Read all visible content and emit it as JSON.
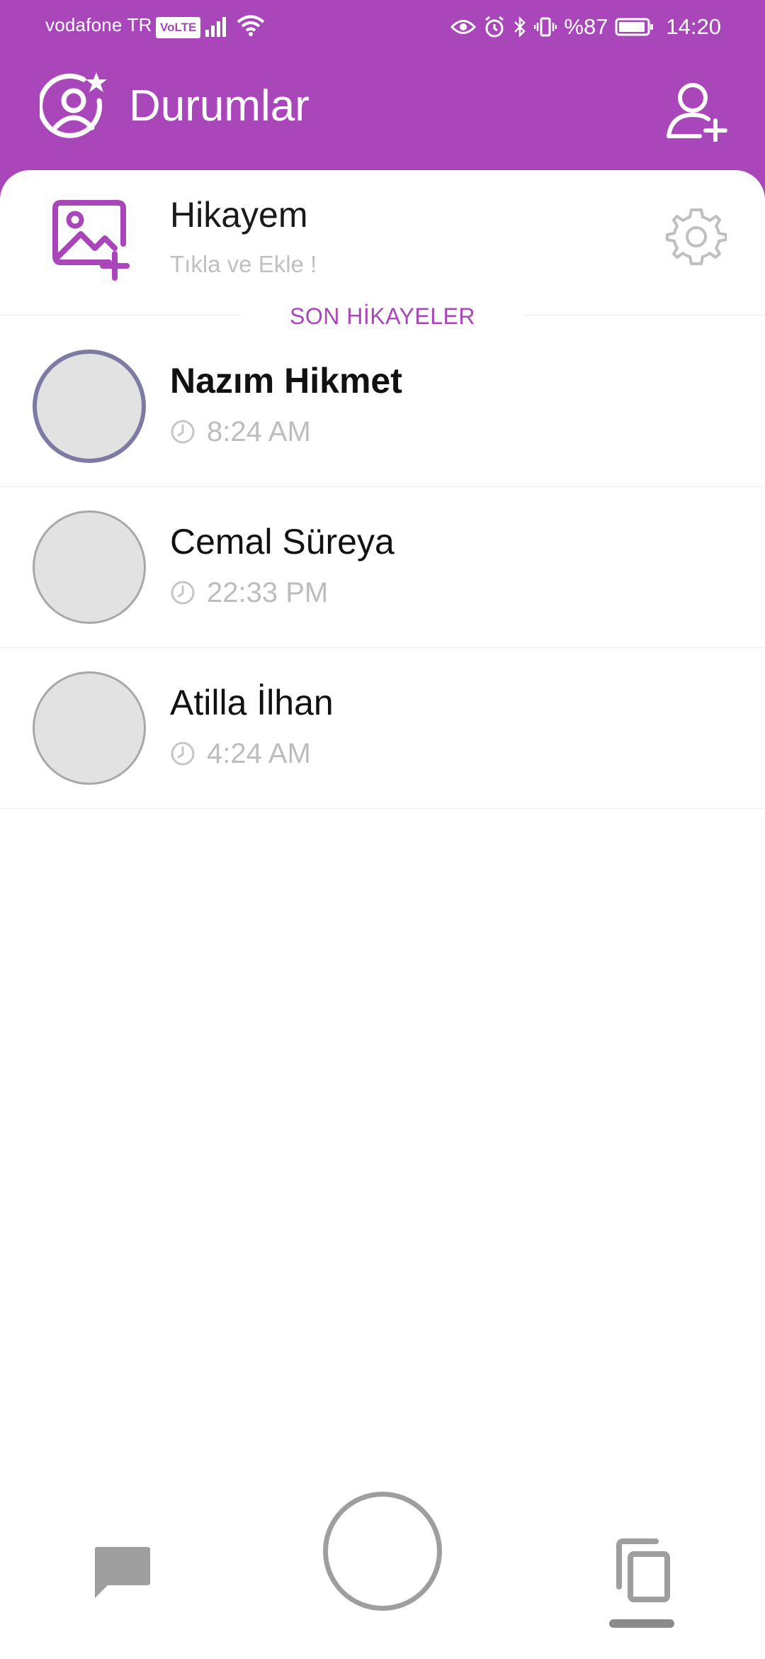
{
  "status_bar": {
    "carrier": "vodafone TR",
    "volte": "VoLTE",
    "battery": "%87",
    "time": "14:20"
  },
  "header": {
    "title": "Durumlar",
    "icons": {
      "title": "user-star-icon",
      "add_user": "add-user-icon"
    }
  },
  "my_story": {
    "name": "Hikayem",
    "hint": "Tıkla ve Ekle !",
    "icons": {
      "add_image": "add-image-icon",
      "settings": "gear-icon"
    }
  },
  "section": {
    "label": "SON HİKAYELER"
  },
  "stories": [
    {
      "name": "Nazım Hikmet",
      "time": "8:24 AM",
      "unseen": true
    },
    {
      "name": "Cemal Süreya",
      "time": "22:33 PM",
      "unseen": false
    },
    {
      "name": "Atilla İlhan",
      "time": "4:24 AM",
      "unseen": false
    }
  ],
  "bottom_nav": {
    "items": [
      "chat-icon",
      "camera-button",
      "stories-icon"
    ],
    "active": "stories-icon"
  },
  "colors": {
    "accent": "#A947BA",
    "unseen_ring": "#7D7BA3",
    "muted_text": "#BDBDBD",
    "nav_icon": "#9E9E9E"
  }
}
